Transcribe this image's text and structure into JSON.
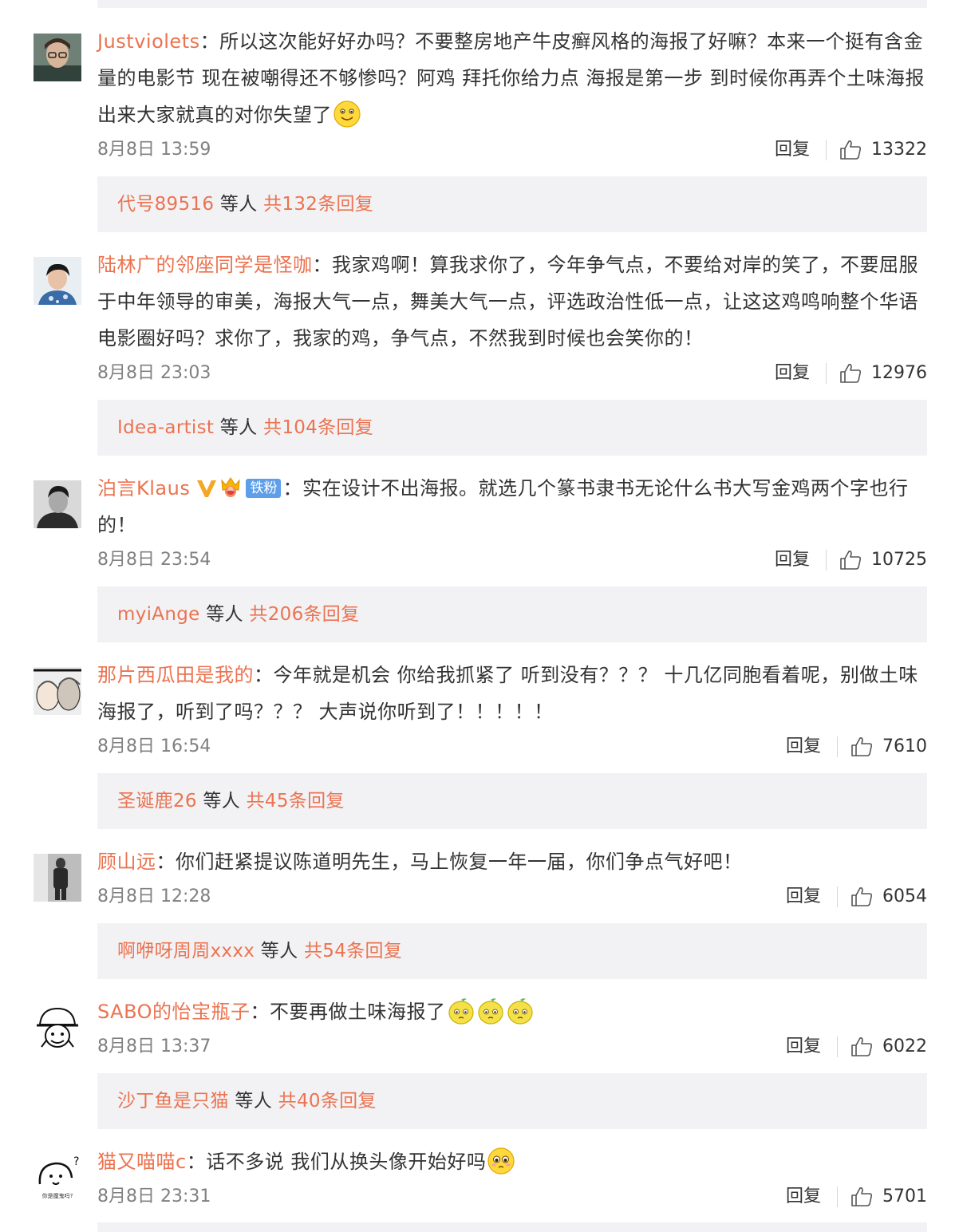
{
  "comments": [
    {
      "username": "Justviolets",
      "colon": "：",
      "text": "所以这次能好好办吗？不要整房地产牛皮癣风格的海报了好嘛？本来一个挺有含金量的电影节 现在被嘲得还不够惨吗？阿鸡 拜托你给力点 海报是第一步 到时候你再弄个土味海报出来大家就真的对你失望了",
      "emoji_name": "smile-emoji",
      "time": "8月8日 13:59",
      "reply_label": "回复",
      "likes": "13322",
      "replies_user": "代号89516",
      "replies_mid": " 等人 ",
      "replies_count": "共132条回复"
    },
    {
      "username": "陆林广的邻座同学是怪咖",
      "colon": "：",
      "text": "我家鸡啊！算我求你了，今年争气点，不要给对岸的笑了，不要屈服于中年领导的审美，海报大气一点，舞美大气一点，评选政治性低一点，让这这鸡鸣响整个华语电影圈好吗？求你了，我家的鸡，争气点，不然我到时候也会笑你的！",
      "time": "8月8日 23:03",
      "reply_label": "回复",
      "likes": "12976",
      "replies_user": "Idea-artist",
      "replies_mid": " 等人 ",
      "replies_count": "共104条回复"
    },
    {
      "username": "泊言Klaus",
      "fan_badge": "铁粉",
      "colon": "：",
      "text": "实在设计不出海报。就选几个篆书隶书无论什么书大写金鸡两个字也行的！",
      "time": "8月8日 23:54",
      "reply_label": "回复",
      "likes": "10725",
      "replies_user": "myiAnge",
      "replies_mid": " 等人 ",
      "replies_count": "共206条回复"
    },
    {
      "username": "那片西瓜田是我的",
      "colon": "：",
      "text": "今年就是机会 你给我抓紧了 听到没有？？？ 十几亿同胞看着呢，别做土味海报了，听到了吗？？？ 大声说你听到了！！！！！",
      "time": "8月8日 16:54",
      "reply_label": "回复",
      "likes": "7610",
      "replies_user": "圣诞鹿26",
      "replies_mid": " 等人 ",
      "replies_count": "共45条回复"
    },
    {
      "username": "顾山远",
      "colon": "：",
      "text": "你们赶紧提议陈道明先生，马上恢复一年一届，你们争点气好吧！",
      "time": "8月8日 12:28",
      "reply_label": "回复",
      "likes": "6054",
      "replies_user": "啊咿呀周周xxxx",
      "replies_mid": " 等人 ",
      "replies_count": "共54条回复"
    },
    {
      "username": "SABO的怡宝瓶子",
      "colon": "：",
      "text": "不要再做土味海报了",
      "emoji_name": "lemon-emoji",
      "time": "8月8日 13:37",
      "reply_label": "回复",
      "likes": "6022",
      "replies_user": "沙丁鱼是只猫",
      "replies_mid": " 等人 ",
      "replies_count": "共40条回复"
    },
    {
      "username": "猫又喵喵c",
      "colon": "：",
      "text": "话不多说 我们从换头像开始好吗",
      "emoji_name": "pleading-emoji",
      "avatar_caption": "你是魔鬼吗?",
      "time": "8月8日 23:31",
      "reply_label": "回复",
      "likes": "5701"
    }
  ],
  "colors": {
    "username": "#eb7350",
    "text": "#333333",
    "meta": "#808080",
    "reply_box_bg": "#f2f2f5",
    "verified_v": "#f5a623",
    "fan_badge_bg": "#5f9fea"
  }
}
